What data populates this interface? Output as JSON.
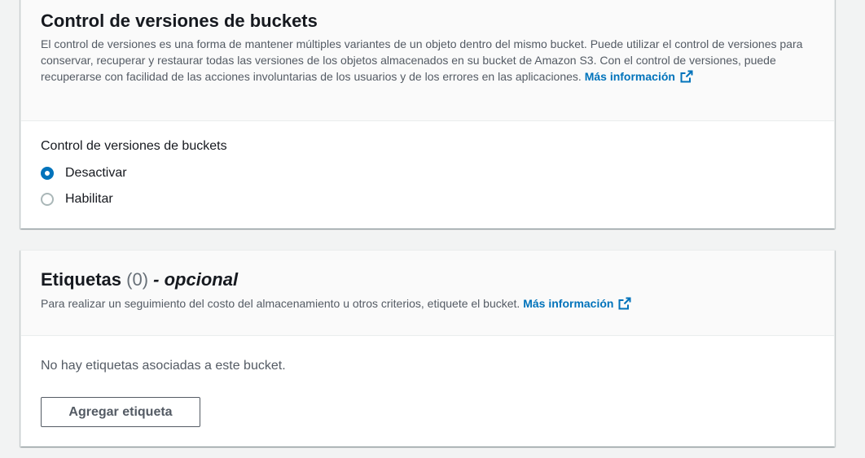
{
  "versioning": {
    "title": "Control de versiones de buckets",
    "description": "El control de versiones es una forma de mantener múltiples variantes de un objeto dentro del mismo bucket. Puede utilizar el control de versiones para conservar, recuperar y restaurar todas las versiones de los objetos almacenados en su bucket de Amazon S3. Con el control de versiones, puede recuperarse con facilidad de las acciones involuntarias de los usuarios y de los errores en las aplicaciones.",
    "learn_more": "Más información",
    "field_label": "Control de versiones de buckets",
    "options": [
      {
        "label": "Desactivar",
        "selected": true
      },
      {
        "label": "Habilitar",
        "selected": false
      }
    ]
  },
  "tags": {
    "title": "Etiquetas",
    "count": "(0)",
    "optional": "- opcional",
    "description": "Para realizar un seguimiento del costo del almacenamiento u otros criterios, etiquete el bucket.",
    "learn_more": "Más información",
    "empty_text": "No hay etiquetas asociadas a este bucket.",
    "add_button": "Agregar etiqueta"
  },
  "colors": {
    "link": "#0073bb",
    "radio_selected": "#0073bb",
    "page_bg": "#f2f3f3",
    "header_bg": "#fafafa"
  },
  "icons": {
    "external_link": "external-link-icon"
  }
}
